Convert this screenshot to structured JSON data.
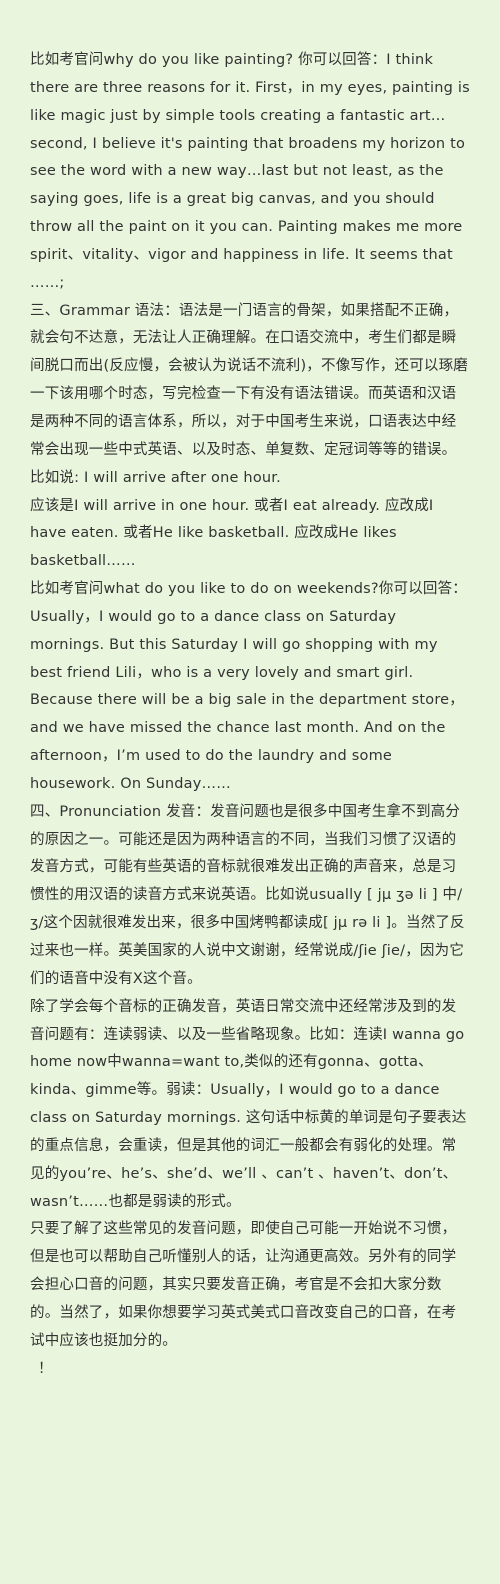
{
  "article": {
    "paragraphs": [
      "比如考官问why do you like painting? 你可以回答：I think there are three reasons for it. First，in my eyes, painting is like magic just by simple tools creating a fantastic art…second, I believe it's painting that broadens my horizon to see the word with a new way…last but not least, as the saying goes, life is a great big canvas, and you should throw all the paint on it you can. Painting makes me more spirit、vitality、vigor and happiness in life. It seems that ……;",
      "三、Grammar 语法：语法是一门语言的骨架，如果搭配不正确，就会句不达意，无法让人正确理解。在口语交流中，考生们都是瞬间脱口而出(反应慢，会被认为说话不流利)，不像写作，还可以琢磨一下该用哪个时态，写完检查一下有没有语法错误。而英语和汉语是两种不同的语言体系，所以，对于中国考生来说，口语表达中经常会出现一些中式英语、以及时态、单复数、定冠词等等的错误。比如说: I will arrive after one hour.",
      "应该是I will arrive in one hour. 或者I eat already. 应改成I have eaten. 或者He like basketball. 应改成He likes basketball……",
      "比如考官问what do you like to do on weekends?你可以回答：Usually，I would go to a dance class on Saturday mornings. But this Saturday I will go shopping with my best friend Lili，who is a very lovely and smart girl. Because there will be a big sale in the department store，and we have missed the chance last month. And on the afternoon，I’m used to do the laundry and some housework. On Sunday……",
      "四、Pronunciation 发音：发音问题也是很多中国考生拿不到高分的原因之一。可能还是因为两种语言的不同，当我们习惯了汉语的发音方式，可能有些英语的音标就很难发出正确的声音来，总是习惯性的用汉语的读音方式来说英语。比如说usually [ jμ ʒə li ] 中/ʒ/这个因就很难发出来，很多中国烤鸭都读成[ jμ rə li ]。当然了反过来也一样。英美国家的人说中文谢谢，经常说成/ʃie ʃie/，因为它们的语音中没有X这个音。",
      "除了学会每个音标的正确发音，英语日常交流中还经常涉及到的发音问题有：连读弱读、以及一些省略现象。比如：连读I wanna go home now中wanna=want to,类似的还有gonna、gotta、kinda、gimme等。弱读：Usually，I would go to a dance class on Saturday mornings. 这句话中标黄的单词是句子要表达的重点信息，会重读，但是其他的词汇一般都会有弱化的处理。常见的you’re、he’s、she’d、we’ll 、can’t 、haven’t、don’t、wasn’t……也都是弱读的形式。",
      "只要了解了这些常见的发音问题，即使自己可能一开始说不习惯，但是也可以帮助自己听懂别人的话，让沟通更高效。另外有的同学会担心口音的问题，其实只要发音正确，考官是不会扣大家分数的。当然了，如果你想要学习英式美式口音改变自己的口音，在考试中应该也挺加分的。"
    ],
    "closing": "！"
  }
}
